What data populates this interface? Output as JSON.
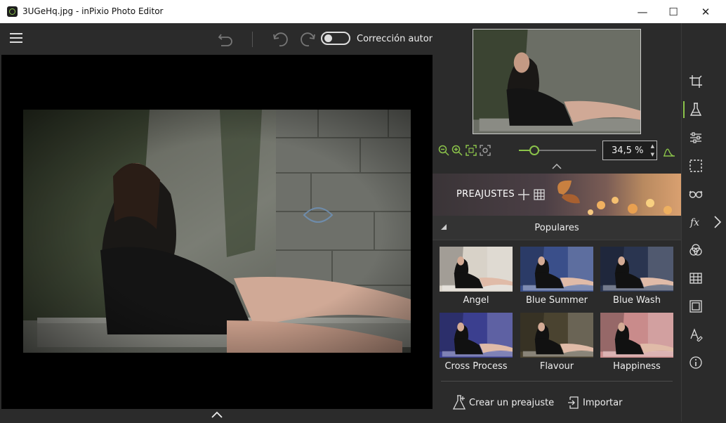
{
  "window": {
    "title": "3UGeHq.jpg - inPixio Photo Editor",
    "minimize": "—",
    "maximize": "☐",
    "close": "✕"
  },
  "toolbar": {
    "auto_correction_label": "Corrección autom",
    "auto_correction_enabled": false
  },
  "zoom": {
    "value": "34,5 %",
    "level_fraction": 0.2
  },
  "presets": {
    "title": "PREAJUSTES",
    "category": "Populares",
    "items": [
      {
        "name": "Angel",
        "tint": "#d8d2c8"
      },
      {
        "name": "Blue Summer",
        "tint": "#3a4f8a"
      },
      {
        "name": "Blue Wash",
        "tint": "#2a3550"
      },
      {
        "name": "Cross Process",
        "tint": "#3b3f8f"
      },
      {
        "name": "Flavour",
        "tint": "#4a4330"
      },
      {
        "name": "Happiness",
        "tint": "#c98b8b"
      }
    ],
    "create_label": "Crear un preajuste",
    "import_label": "Importar"
  },
  "colors": {
    "accent": "#8bc34a",
    "panel": "#2b2b2b",
    "canvas": "#000000"
  },
  "sidebar_tools": [
    "crop-icon",
    "flask-icon",
    "adjust-sliders-icon",
    "selection-icon",
    "glasses-icon",
    "fx-icon",
    "color-circles-icon",
    "texture-grid-icon",
    "frame-icon",
    "text-icon",
    "info-icon"
  ]
}
